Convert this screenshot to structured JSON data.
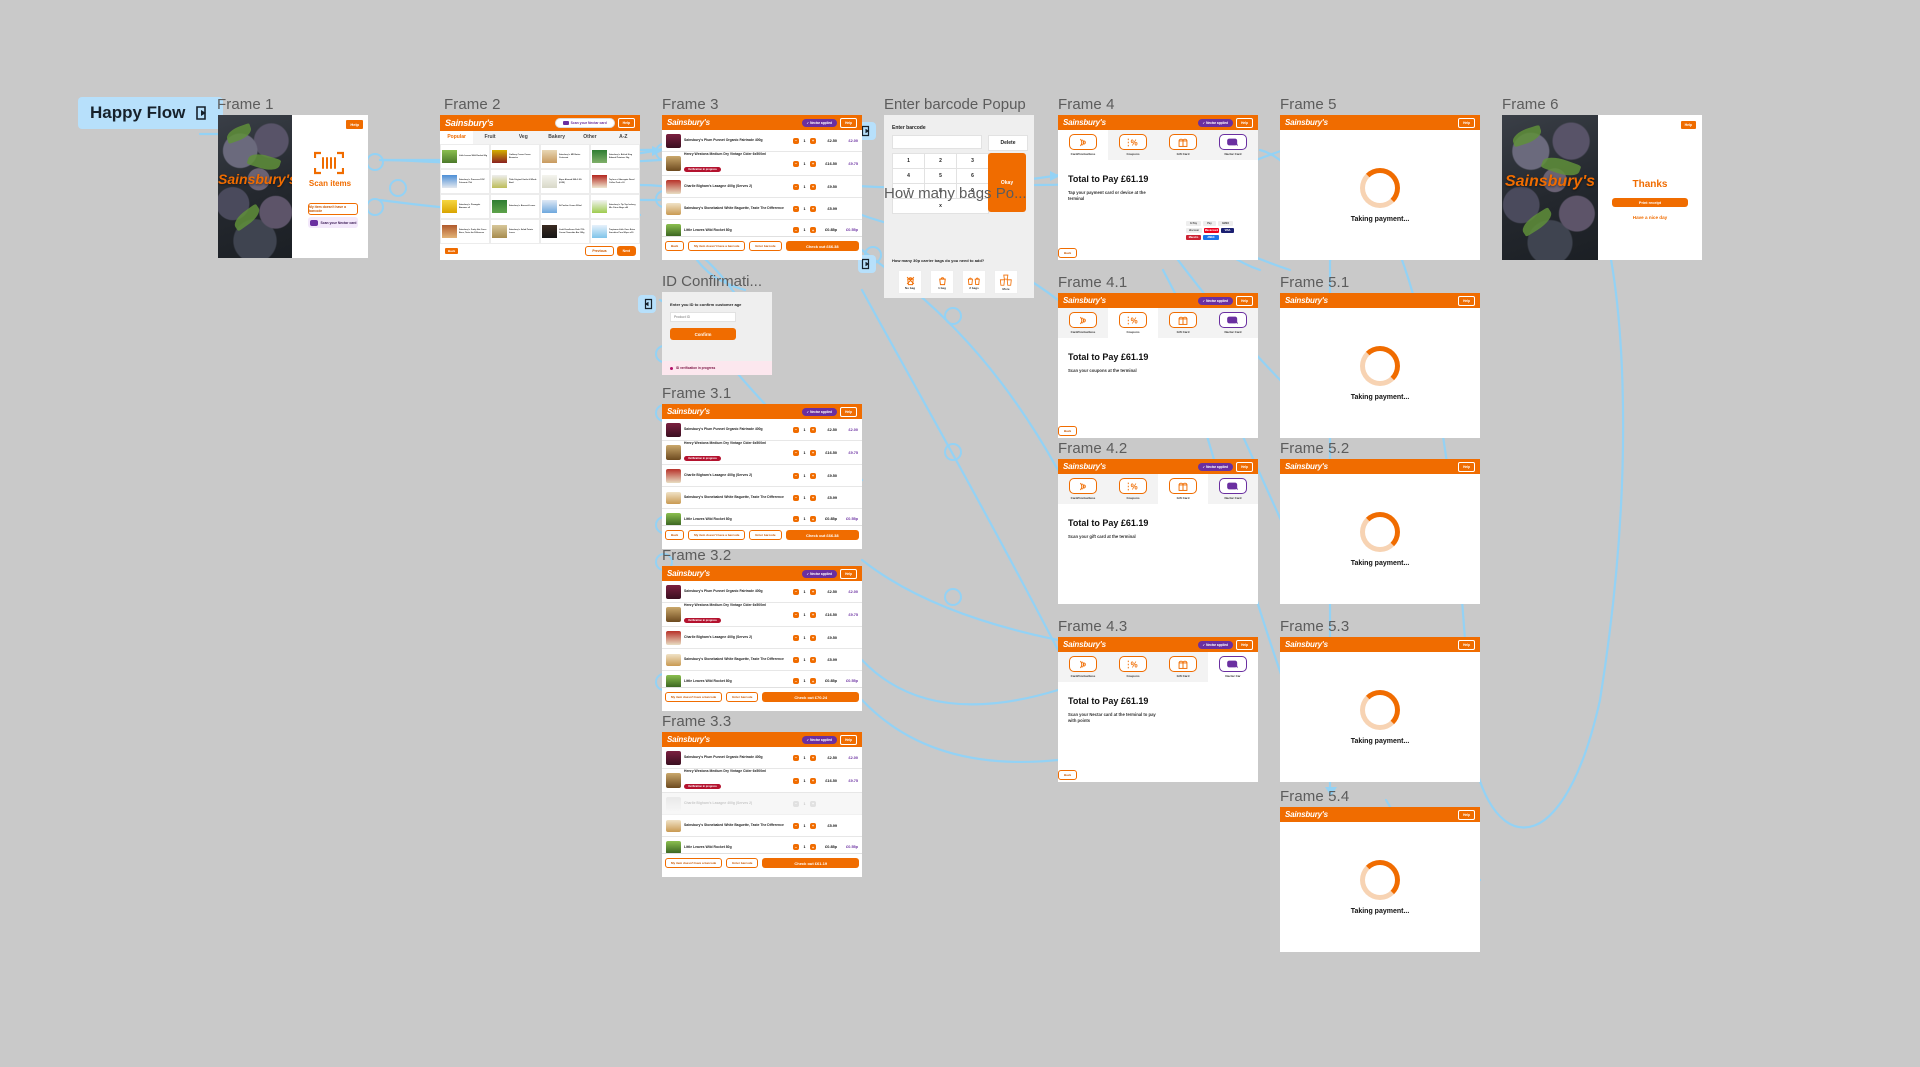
{
  "canvas": {
    "background": "#c9c9c9",
    "accent_orange": "#f06c00",
    "nectar_purple": "#6a2fa0",
    "connector_blue": "#93d2f5",
    "flow_badge": {
      "label": "Happy Flow",
      "icon": "flow-start-icon"
    }
  },
  "brand": {
    "name": "Sainsbury's"
  },
  "common": {
    "help_label": "Help",
    "nectar_applied_label": "Nectar applied",
    "nectar_scan_label": "Scan your Nectar card",
    "back_label": "Back"
  },
  "frames": [
    {
      "id": "frame-1",
      "label": "Frame 1",
      "type": "welcome",
      "help_label": "Help",
      "scan_title": "Scan items",
      "scan_icon": "barcode-scan-icon",
      "no_barcode_label": "My item doesn't have a barcode",
      "nectar_label": "Scan your Nectar card",
      "brand_text": "Sainsbury's"
    },
    {
      "id": "frame-2",
      "label": "Frame 2",
      "type": "catalogue",
      "nectar_button": "Scan your Nectar card",
      "help_label": "Help",
      "tabs": [
        {
          "label": "Popular",
          "active": true
        },
        {
          "label": "Fruit",
          "active": false
        },
        {
          "label": "Veg",
          "active": false
        },
        {
          "label": "Bakery",
          "active": false
        },
        {
          "label": "Other",
          "active": false
        },
        {
          "label": "A-Z",
          "active": false
        }
      ],
      "products": [
        "Little Leaves Wild Rocket 80g",
        "Cadbury Cocoa Cream Brownies",
        "Sainsbury's British King Edward Potatoes 2kg",
        "Sainsbury's MD Butter Croissant",
        "Sainsbury's Prosecco DOC Frizzante 75cl",
        "Tilda Original Garlic & Whole Basil",
        "Alpro Almond Milk 2.0% (0.85l)",
        "Taylors of Harrogate Decaf Coffee Pods x10",
        "Sainsbury's Pineapple Bananas x5",
        "Sainsbury's Broccoli Loose",
        "St Pauline Cream 300ml",
        "Sainsbury's Tip Top Iceberg Mix Citrus Bags x40",
        "Sainsbury's Fruity Hot Cross Buns, Taste the Difference",
        "Sainsbury's Salad Potato Loose",
        "Lindt Excellence Dark 70% Cocoa Chocolate Bar 100g",
        "Tropicana Little Ones Extra Sunshine Pure Wipes x30"
      ],
      "pagination": {
        "previous": "Previous",
        "next": "Next"
      }
    },
    {
      "id": "frame-3",
      "label": "Frame 3",
      "type": "basket",
      "nectar_applied": "Nectar applied",
      "help_label": "Help",
      "checkout_label": "Check out £66.38",
      "items": [
        {
          "name": "Sainsbury's Plum Punnet Organic Fairtrade 400g",
          "qty": "1",
          "price": "£2.50",
          "nectar_price": "£2.00",
          "thumb": "plums-thumb"
        },
        {
          "name": "Henry Westons Medium Dry Vintage Cider 6x500ml",
          "qty": "1",
          "price": "£16.50",
          "nectar_price": "£9.75",
          "thumb": "cider-thumb",
          "badge": "Verification in progress"
        },
        {
          "name": "Charlie Bigham's Lasagne 400g (Serves 2)",
          "qty": "1",
          "price": "£9.50",
          "nectar_price": "",
          "thumb": "lasagne-thumb"
        },
        {
          "name": "Sainsbury's Stonebaked White Baguette, Taste The Difference",
          "qty": "1",
          "price": "£5.99",
          "nectar_price": "",
          "thumb": "baguette-thumb"
        },
        {
          "name": "Little Leaves Wild Rocket 80g",
          "qty": "1",
          "price": "£0.85p",
          "nectar_price": "£0.55p",
          "thumb": "rocket-thumb"
        }
      ],
      "footer_buttons": [
        "Back",
        "My item doesn't have a barcode",
        "Enter barcode"
      ]
    },
    {
      "id": "frame-3-1",
      "label": "Frame 3.1",
      "type": "basket",
      "nectar_applied": "Nectar applied",
      "help_label": "Help",
      "checkout_label": "Check out £66.38",
      "items": [
        {
          "name": "Sainsbury's Plum Punnet Organic Fairtrade 400g",
          "qty": "1",
          "price": "£2.50",
          "nectar_price": "£2.00",
          "thumb": "plums-thumb"
        },
        {
          "name": "Henry Westons Medium Dry Vintage Cider 6x500ml",
          "qty": "1",
          "price": "£16.50",
          "nectar_price": "£9.75",
          "thumb": "cider-thumb",
          "badge": "Verification in progress"
        },
        {
          "name": "Charlie Bigham's Lasagne 400g (Serves 2)",
          "qty": "1",
          "price": "£9.50",
          "nectar_price": "",
          "thumb": "lasagne-thumb"
        },
        {
          "name": "Sainsbury's Stonebaked White Baguette, Taste The Difference",
          "qty": "1",
          "price": "£5.99",
          "nectar_price": "",
          "thumb": "baguette-thumb"
        },
        {
          "name": "Little Leaves Wild Rocket 80g",
          "qty": "1",
          "price": "£0.85p",
          "nectar_price": "£0.55p",
          "thumb": "rocket-thumb"
        }
      ],
      "footer_buttons": [
        "Back",
        "My item doesn't have a barcode",
        "Enter barcode"
      ]
    },
    {
      "id": "frame-3-2",
      "label": "Frame 3.2",
      "type": "basket",
      "nectar_applied": "Nectar applied",
      "help_label": "Help",
      "checkout_label": "Check out £70.24",
      "items": [
        {
          "name": "Sainsbury's Plum Punnet Organic Fairtrade 400g",
          "qty": "1",
          "price": "£2.50",
          "nectar_price": "£2.00",
          "thumb": "plums-thumb"
        },
        {
          "name": "Henry Westons Medium Dry Vintage Cider 6x500ml",
          "qty": "1",
          "price": "£16.50",
          "nectar_price": "£9.75",
          "thumb": "cider-thumb",
          "badge": "Verification in progress"
        },
        {
          "name": "Charlie Bigham's Lasagne 400g (Serves 2)",
          "qty": "1",
          "price": "£9.50",
          "nectar_price": "",
          "thumb": "lasagne-thumb"
        },
        {
          "name": "Sainsbury's Stonebaked White Baguette, Taste The Difference",
          "qty": "1",
          "price": "£5.99",
          "nectar_price": "",
          "thumb": "baguette-thumb"
        },
        {
          "name": "Little Leaves Wild Rocket 80g",
          "qty": "1",
          "price": "£0.85p",
          "nectar_price": "£0.55p",
          "thumb": "rocket-thumb"
        }
      ],
      "footer_buttons": [
        "My item doesn't have a barcode",
        "Enter barcode"
      ]
    },
    {
      "id": "frame-3-3",
      "label": "Frame 3.3",
      "type": "basket",
      "nectar_applied": "Nectar applied",
      "help_label": "Help",
      "checkout_label": "Check out £61.19",
      "items": [
        {
          "name": "Sainsbury's Plum Punnet Organic Fairtrade 400g",
          "qty": "1",
          "price": "£2.50",
          "nectar_price": "£2.00",
          "thumb": "plums-thumb"
        },
        {
          "name": "Henry Westons Medium Dry Vintage Cider 6x500ml",
          "qty": "1",
          "price": "£16.50",
          "nectar_price": "£9.75",
          "thumb": "cider-thumb",
          "badge": "Verification in progress"
        },
        {
          "name": "Charlie Bigham's Lasagne 400g (Serves 2)",
          "qty": "1",
          "price": "",
          "nectar_price": "",
          "thumb": "lasagne-thumb",
          "removed": true
        },
        {
          "name": "Sainsbury's Stonebaked White Baguette, Taste The Difference",
          "qty": "1",
          "price": "£5.99",
          "nectar_price": "",
          "thumb": "baguette-thumb"
        },
        {
          "name": "Little Leaves Wild Rocket 80g",
          "qty": "1",
          "price": "£0.85p",
          "nectar_price": "£0.55p",
          "thumb": "rocket-thumb"
        }
      ],
      "footer_buttons": [
        "My item doesn't have a barcode",
        "Enter barcode"
      ]
    },
    {
      "id": "frame-4",
      "label": "Frame 4",
      "type": "payment",
      "nectar_applied": "Nectar applied",
      "help_label": "Help",
      "active_option": 0,
      "options": [
        {
          "label": "Card/Contactless",
          "icon": "contactless-icon"
        },
        {
          "label": "Coupons",
          "icon": "percent-coupon-icon"
        },
        {
          "label": "Gift Card",
          "icon": "gift-card-icon"
        },
        {
          "label": "Nectar Card",
          "icon": "nectar-card-icon"
        }
      ],
      "total": "Total to Pay £61.19",
      "instruction": "Tap your payment card or device at the terminal",
      "show_brands": true,
      "brands": [
        "G Pay",
        "Pay",
        "AMEX",
        "discover",
        "Mastercard",
        "VISA",
        "Maestro",
        "AMEX"
      ],
      "back_label": "Back"
    },
    {
      "id": "frame-4-1",
      "label": "Frame 4.1",
      "type": "payment",
      "nectar_applied": "Nectar applied",
      "help_label": "Help",
      "active_option": 1,
      "options": [
        {
          "label": "Card/Contactless",
          "icon": "contactless-icon"
        },
        {
          "label": "Coupons",
          "icon": "percent-coupon-icon"
        },
        {
          "label": "Gift Card",
          "icon": "gift-card-icon"
        },
        {
          "label": "Nectar Card",
          "icon": "nectar-card-icon"
        }
      ],
      "total": "Total to Pay £61.19",
      "instruction": "Scan your coupons at the terminal",
      "show_brands": false,
      "back_label": "Back"
    },
    {
      "id": "frame-4-2",
      "label": "Frame 4.2",
      "type": "payment",
      "nectar_applied": "Nectar applied",
      "help_label": "Help",
      "active_option": 2,
      "options": [
        {
          "label": "Card/Contactless",
          "icon": "contactless-icon"
        },
        {
          "label": "Coupons",
          "icon": "percent-coupon-icon"
        },
        {
          "label": "Gift Card",
          "icon": "gift-card-icon"
        },
        {
          "label": "Nectar Card",
          "icon": "nectar-card-icon"
        }
      ],
      "total": "Total to Pay £61.19",
      "instruction": "Scan your gift card at the terminal",
      "show_brands": false,
      "back_label": "Back"
    },
    {
      "id": "frame-4-3",
      "label": "Frame 4.3",
      "type": "payment",
      "nectar_applied": "Nectar applied",
      "help_label": "Help",
      "active_option": 3,
      "options": [
        {
          "label": "Card/Contactless",
          "icon": "contactless-icon"
        },
        {
          "label": "Coupons",
          "icon": "percent-coupon-icon"
        },
        {
          "label": "Gift Card",
          "icon": "gift-card-icon"
        },
        {
          "label": "Nectar Car",
          "icon": "nectar-card-icon"
        }
      ],
      "total": "Total to Pay £61.19",
      "instruction": "Scan your Nectar card at the terminal to pay with points",
      "show_brands": false,
      "back_label": "Back"
    },
    {
      "id": "frame-5",
      "label": "Frame 5",
      "type": "loading",
      "help_label": "Help",
      "status": "Taking payment..."
    },
    {
      "id": "frame-5-1",
      "label": "Frame 5.1",
      "type": "loading",
      "help_label": "Help",
      "status": "Taking payment..."
    },
    {
      "id": "frame-5-2",
      "label": "Frame 5.2",
      "type": "loading",
      "help_label": "Help",
      "status": "Taking payment..."
    },
    {
      "id": "frame-5-3",
      "label": "Frame 5.3",
      "type": "loading",
      "help_label": "Help",
      "status": "Taking payment..."
    },
    {
      "id": "frame-5-4",
      "label": "Frame 5.4",
      "type": "loading",
      "help_label": "Help",
      "status": "Taking payment..."
    },
    {
      "id": "frame-6",
      "label": "Frame 6",
      "type": "thanks",
      "help_label": "Help",
      "brand_text": "Sainsbury's",
      "title": "Thanks",
      "print_label": "Print receipt",
      "farewell": "Have a nice day"
    }
  ],
  "popups": [
    {
      "id": "barcode-popup",
      "label": "Enter barcode Popup",
      "title": "Enter barcode",
      "input_value": "",
      "delete_label": "Delete",
      "ok_label": "Okay",
      "keys": [
        "1",
        "2",
        "3",
        "4",
        "5",
        "6",
        "7",
        "8",
        "9",
        "x"
      ]
    },
    {
      "id": "bags-popup",
      "label": "How many bags Po...",
      "question": "How many 30p carrier bags do you need to add?",
      "options": [
        {
          "label": "No bag",
          "icon": "no-bag-icon"
        },
        {
          "label": "1 bag",
          "icon": "one-bag-icon"
        },
        {
          "label": "2 bags",
          "icon": "two-bags-icon"
        },
        {
          "label": "More",
          "icon": "more-bags-icon"
        }
      ]
    },
    {
      "id": "id-confirmation-popup",
      "label": "ID Confirmati...",
      "prompt": "Enter you ID to confirm customer age",
      "input_placeholder": "Product ID",
      "confirm_label": "Confirm",
      "status": "ID verification in progress"
    }
  ]
}
